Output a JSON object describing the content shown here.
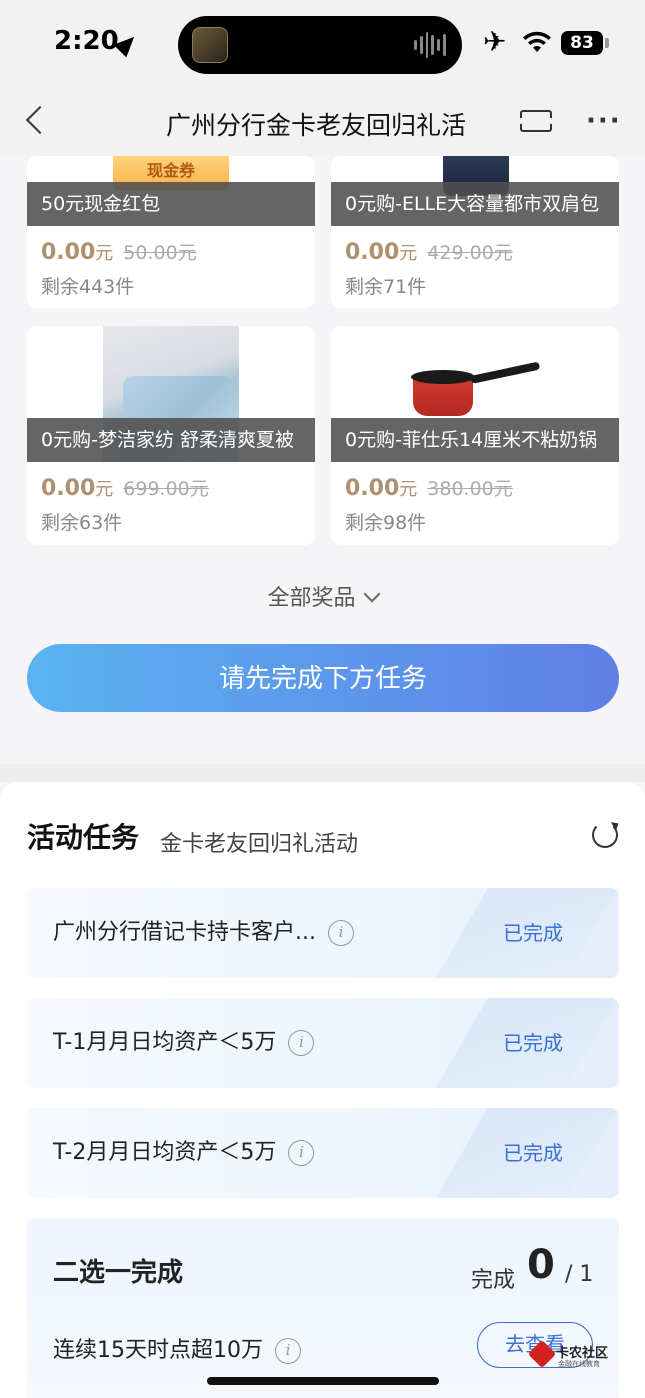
{
  "status_bar": {
    "time": "2:20",
    "battery": "83",
    "icons": [
      "location-arrow-icon",
      "app-icon",
      "audio-wave-icon",
      "airplane-icon",
      "wifi-icon",
      "battery-icon"
    ]
  },
  "nav": {
    "title": "广州分行金卡老友回归礼活",
    "icons": [
      "back-icon",
      "ticket-icon",
      "more-icon"
    ]
  },
  "products": [
    {
      "image_label": "现金券",
      "name": "50元现金红包",
      "price": "0.00",
      "unit": "元",
      "original": "50.00元",
      "stock": "剩余443件"
    },
    {
      "name": "0元购-ELLE大容量都市双肩包",
      "price": "0.00",
      "unit": "元",
      "original": "429.00元",
      "stock": "剩余71件"
    },
    {
      "name": "0元购-梦洁家纺 舒柔清爽夏被",
      "price": "0.00",
      "unit": "元",
      "original": "699.00元",
      "stock": "剩余63件"
    },
    {
      "name": "0元购-菲仕乐14厘米不粘奶锅",
      "price": "0.00",
      "unit": "元",
      "original": "380.00元",
      "stock": "剩余98件"
    }
  ],
  "all_prizes": "全部奖品",
  "cta": "请先完成下方任务",
  "tasks": {
    "heading": "活动任务",
    "subheading": "金卡老友回归礼活动",
    "items": [
      {
        "label": "广州分行借记卡持卡客户...",
        "status": "已完成"
      },
      {
        "label": "T-1月月日均资产＜5万",
        "status": "已完成"
      },
      {
        "label": "T-2月月日均资产＜5万",
        "status": "已完成"
      }
    ],
    "choice": {
      "title": "二选一完成",
      "progress_label": "完成",
      "progress_done": "0",
      "progress_total": "/ 1",
      "row_label": "连续15天时点超10万",
      "button": "去查看"
    }
  },
  "watermark": {
    "text": "卡农社区",
    "sub": "金融在线教育"
  },
  "colors": {
    "accent": "#3b6fd0",
    "price": "#b09070",
    "cta_start": "#5ab3f0",
    "cta_end": "#5f7ee6"
  }
}
